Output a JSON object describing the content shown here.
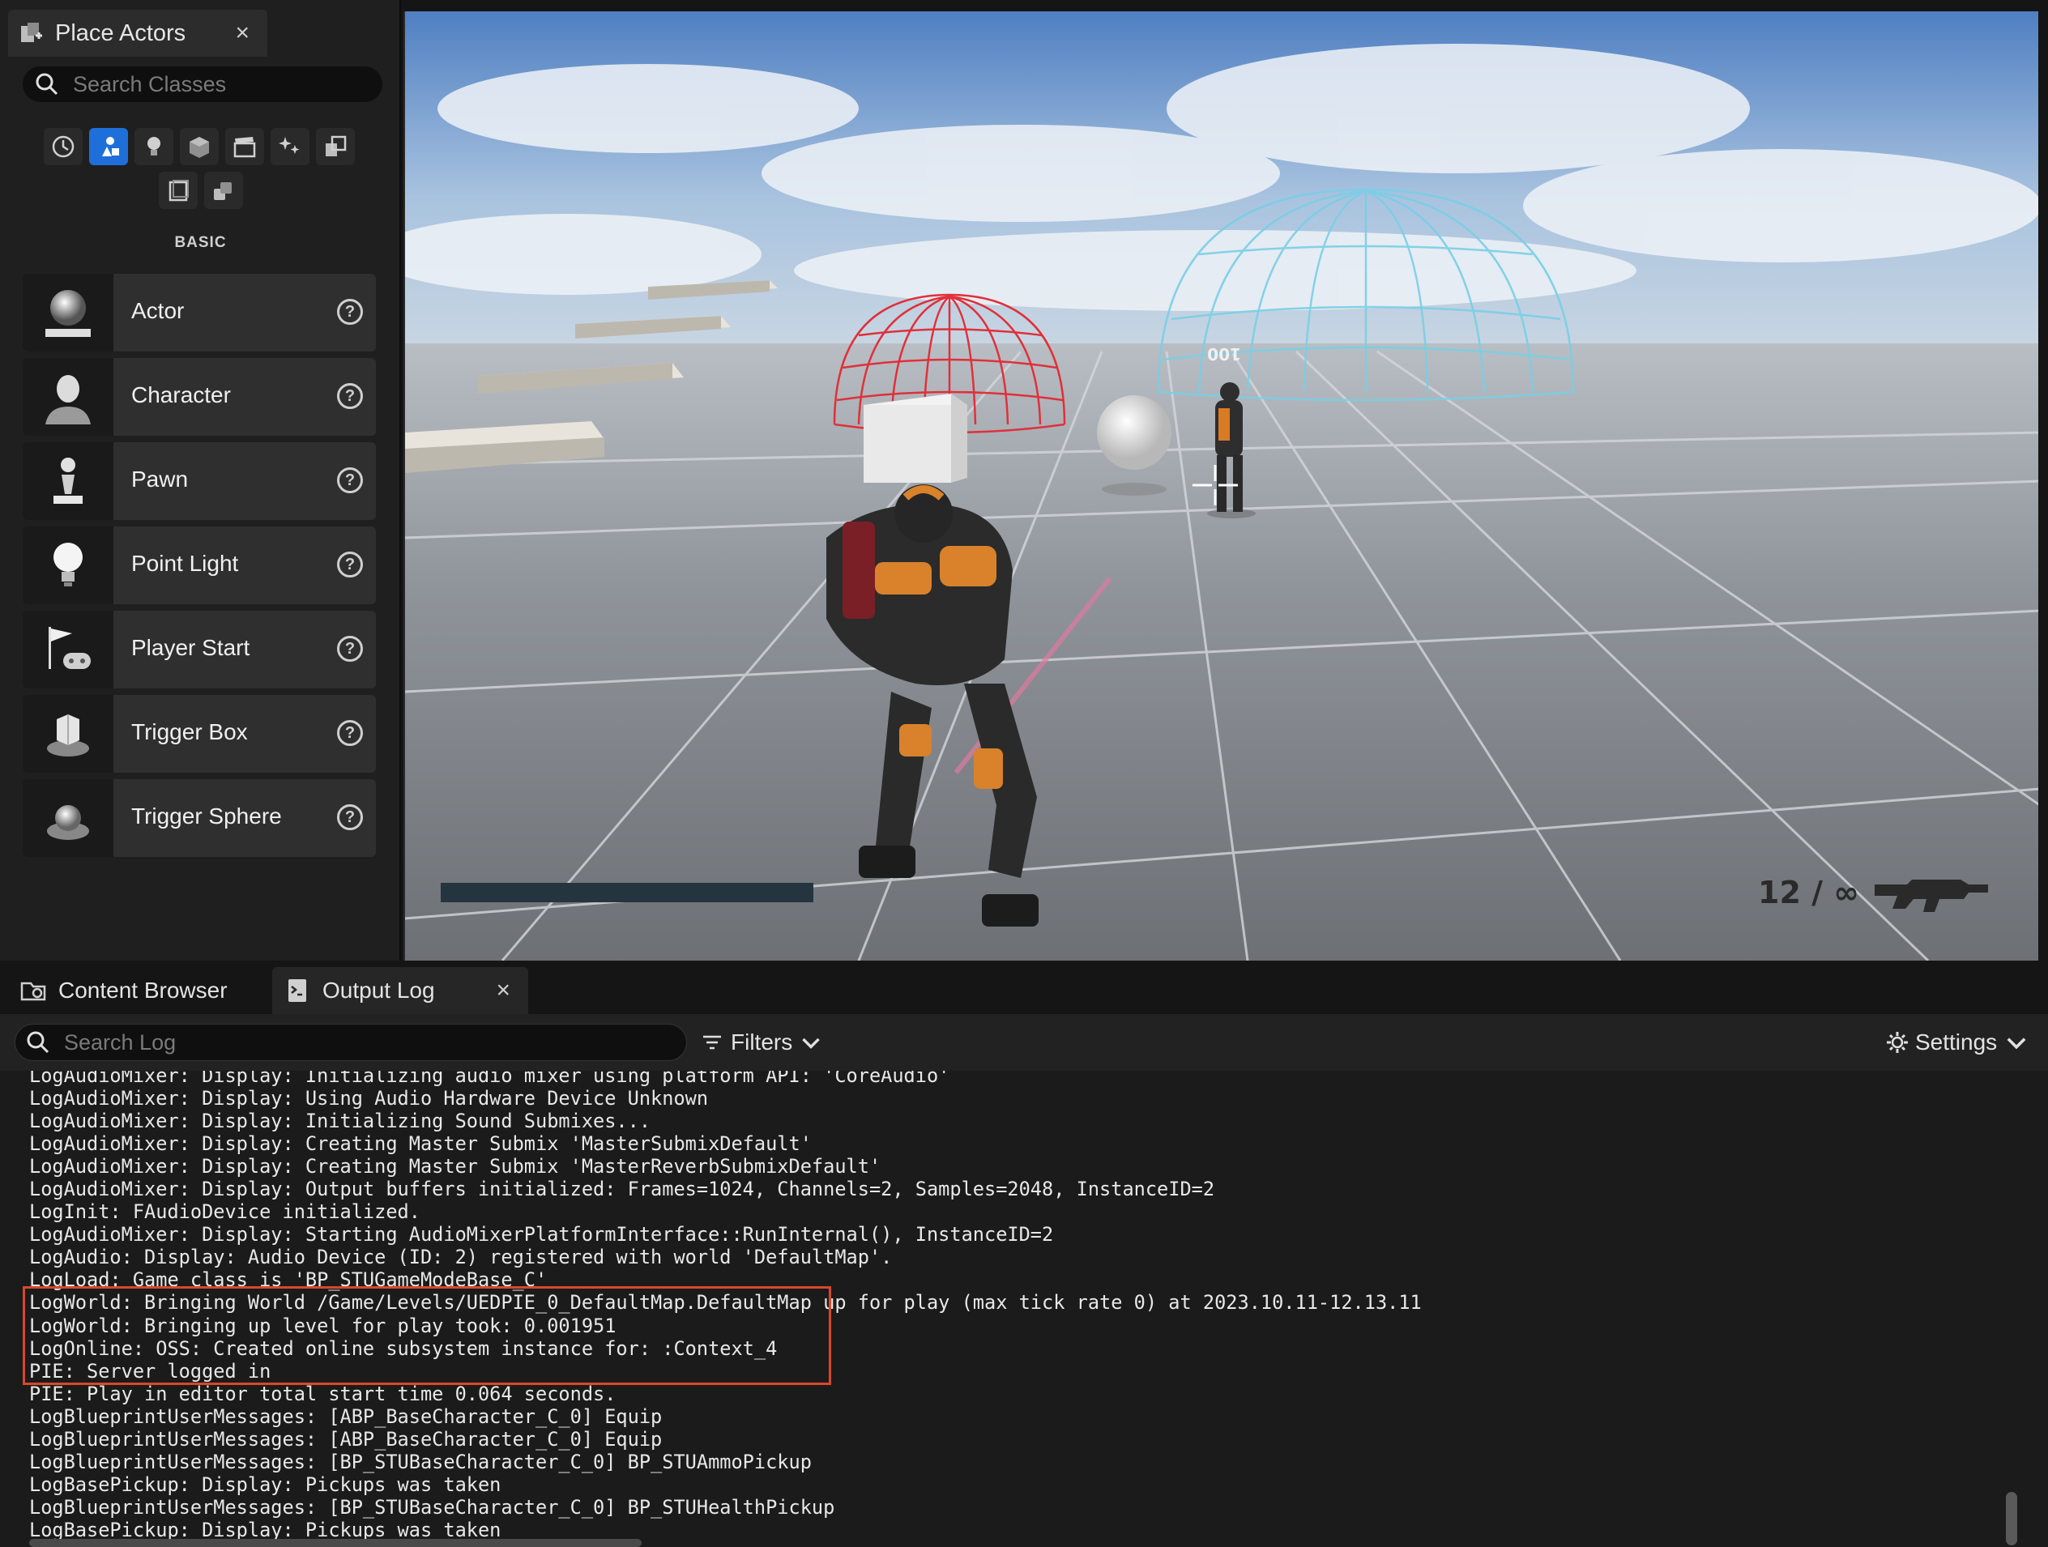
{
  "place_actors": {
    "tab_title": "Place Actors",
    "close_glyph": "×",
    "search_placeholder": "Search Classes",
    "categories": [
      {
        "icon": "clock-icon",
        "active": false
      },
      {
        "icon": "basic-shapes-icon",
        "active": true
      },
      {
        "icon": "lightbulb-icon",
        "active": false
      },
      {
        "icon": "cube-icon",
        "active": false
      },
      {
        "icon": "clapperboard-icon",
        "active": false
      },
      {
        "icon": "sparkle-icon",
        "active": false
      },
      {
        "icon": "volumes-icon",
        "active": false
      },
      {
        "icon": "all-classes-icon",
        "active": false
      },
      {
        "icon": "shapes-icon",
        "active": false
      }
    ],
    "section_label": "BASIC",
    "items": [
      {
        "label": "Actor",
        "icon": "sphere-pedestal-icon"
      },
      {
        "label": "Character",
        "icon": "character-bust-icon"
      },
      {
        "label": "Pawn",
        "icon": "chess-pawn-icon"
      },
      {
        "label": "Point Light",
        "icon": "lightbulb-icon"
      },
      {
        "label": "Player Start",
        "icon": "flag-gamepad-icon"
      },
      {
        "label": "Trigger Box",
        "icon": "trigger-box-icon"
      },
      {
        "label": "Trigger Sphere",
        "icon": "trigger-sphere-icon"
      }
    ],
    "help_glyph": "?"
  },
  "viewport": {
    "ammo": "12 / ∞",
    "world_text": "100",
    "health_fraction": 1.0
  },
  "bottom_panel": {
    "tabs": [
      {
        "label": "Content Browser",
        "icon": "folder-icon"
      },
      {
        "label": "Output Log",
        "icon": "output-log-icon",
        "active": true
      }
    ],
    "close_glyph": "×",
    "search_placeholder": "Search Log",
    "filters_label": "Filters",
    "settings_label": "Settings"
  },
  "log_lines": [
    "LogAudioMixer: Display: Initializing audio mixer using platform API: 'CoreAudio'",
    "LogAudioMixer: Display: Using Audio Hardware Device Unknown",
    "LogAudioMixer: Display: Initializing Sound Submixes...",
    "LogAudioMixer: Display: Creating Master Submix 'MasterSubmixDefault'",
    "LogAudioMixer: Display: Creating Master Submix 'MasterReverbSubmixDefault'",
    "LogAudioMixer: Display: Output buffers initialized: Frames=1024, Channels=2, Samples=2048, InstanceID=2",
    "LogInit: FAudioDevice initialized.",
    "LogAudioMixer: Display: Starting AudioMixerPlatformInterface::RunInternal(), InstanceID=2",
    "LogAudio: Display: Audio Device (ID: 2) registered with world 'DefaultMap'.",
    "LogLoad: Game class is 'BP_STUGameModeBase_C'",
    "LogWorld: Bringing World /Game/Levels/UEDPIE_0_DefaultMap.DefaultMap up for play (max tick rate 0) at 2023.10.11-12.13.11",
    "LogWorld: Bringing up level for play took: 0.001951",
    "LogOnline: OSS: Created online subsystem instance for: :Context_4",
    "PIE: Server logged in",
    "PIE: Play in editor total start time 0.064 seconds.",
    "LogBlueprintUserMessages: [ABP_BaseCharacter_C_0] Equip",
    "LogBlueprintUserMessages: [ABP_BaseCharacter_C_0] Equip",
    "LogBlueprintUserMessages: [BP_STUBaseCharacter_C_0] BP_STUAmmoPickup",
    "LogBasePickup: Display: Pickups was taken",
    "LogBlueprintUserMessages: [BP_STUBaseCharacter_C_0] BP_STUHealthPickup",
    "LogBasePickup: Display: Pickups was taken"
  ],
  "colors": {
    "accent": "#1e6fd9",
    "highlight": "#d9472b",
    "panel": "#1f1f1f"
  }
}
